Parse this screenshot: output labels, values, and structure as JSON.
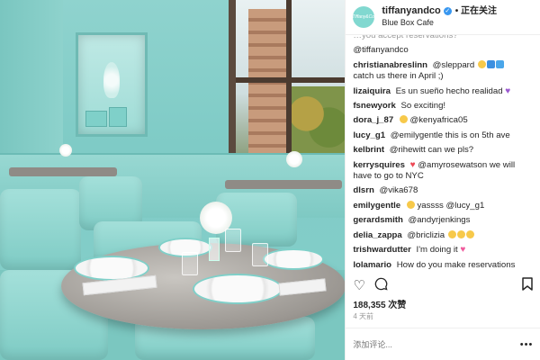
{
  "header": {
    "avatar_text": "Tiffany&Co.",
    "username": "tiffanyandco",
    "follow_label": "• 正在关注",
    "location": "Blue Box Cafe"
  },
  "comments": {
    "cut_text": "…you accept reservations?",
    "items": [
      {
        "user": "",
        "text": "@tiffanyandco"
      },
      {
        "user": "christianabreslinn",
        "text": "@sleppard",
        "emoji_tail": "yellow-blue-blue",
        "text2": "catch us there in April ;)"
      },
      {
        "user": "lizaiquira",
        "text": "Es un sueño hecho realidad",
        "emoji_tail": "purple-heart"
      },
      {
        "user": "fsnewyork",
        "text": "So exciting!"
      },
      {
        "user": "dora_j_87",
        "text": "@kenyafrica05",
        "emoji_pre": "yellow"
      },
      {
        "user": "lucy_g1",
        "text": "@emilygentle this is on 5th ave"
      },
      {
        "user": "kelbrint",
        "text": "@rihewitt can we pls?"
      },
      {
        "user": "kerrysquires",
        "text": "@amyrosewatson we will have to go to NYC",
        "emoji_pre": "red-heart"
      },
      {
        "user": "dlsrn",
        "text": "@vika678"
      },
      {
        "user": "emilygentle",
        "text": "yassss @lucy_g1",
        "emoji_pre": "yellow"
      },
      {
        "user": "gerardsmith",
        "text": "@andyrjenkings"
      },
      {
        "user": "delia_zappa",
        "text": "@briclizia",
        "emoji_tail": "yellow-yellow-yellow"
      },
      {
        "user": "trishwardutter",
        "text": "I'm doing it",
        "emoji_tail": "pink-heart"
      },
      {
        "user": "lolamario",
        "text": "How do you make reservations"
      }
    ]
  },
  "actions": {
    "like_icon": "heart-outline-icon",
    "comment_icon": "comment-icon",
    "bookmark_icon": "bookmark-icon"
  },
  "likes": "188,355 次赞",
  "timestamp": "4 天前",
  "add_comment_placeholder": "添加评论...",
  "more_label": "•••",
  "colors": {
    "accent": "#81d8d0",
    "verified": "#3897f0",
    "heart_red": "#ed4956"
  }
}
